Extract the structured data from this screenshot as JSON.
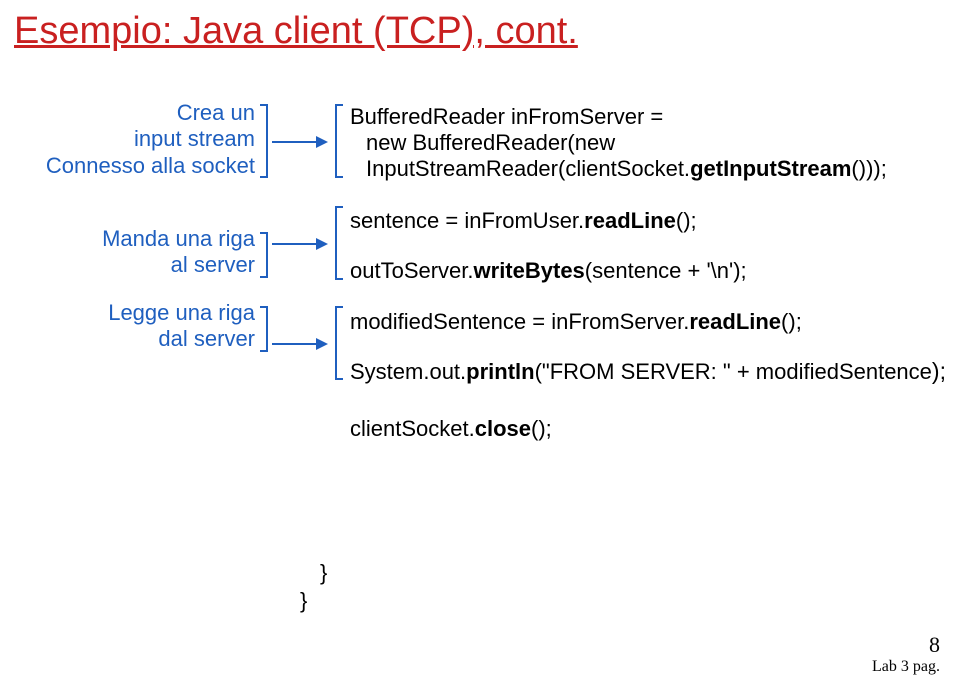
{
  "title": "Esempio: Java client (TCP), cont.",
  "labels": {
    "l1a": "Crea un",
    "l1b": "input stream",
    "l1c": "Connesso alla socket",
    "l2a": "Manda una riga",
    "l2b": "al server",
    "l3a": "Legge una riga",
    "l3b": "dal server"
  },
  "code": {
    "c1": "BufferedReader inFromServer =",
    "c2": "new BufferedReader(new",
    "c3": "InputStreamReader(clientSocket.",
    "c3b": "getInputStream",
    "c3c": "()));",
    "c4": "sentence = inFromUser.",
    "c4b": "readLine",
    "c4c": "();",
    "c5": "outToServer.",
    "c5b": "writeBytes",
    "c5c": "(sentence + '\\n');",
    "c6": "modifiedSentence = inFromServer.",
    "c6b": "readLine",
    "c6c": "();",
    "c7": "System.out.",
    "c7b": "println",
    "c7c": "(\"FROM SERVER: \" + modifiedSentence",
    "c7d": ");",
    "c8": "clientSocket.",
    "c8b": "close",
    "c8c": "();",
    "brace1": "}",
    "brace2": "}"
  },
  "footer": {
    "pagenum": "8",
    "lab": "Lab 3 pag."
  }
}
